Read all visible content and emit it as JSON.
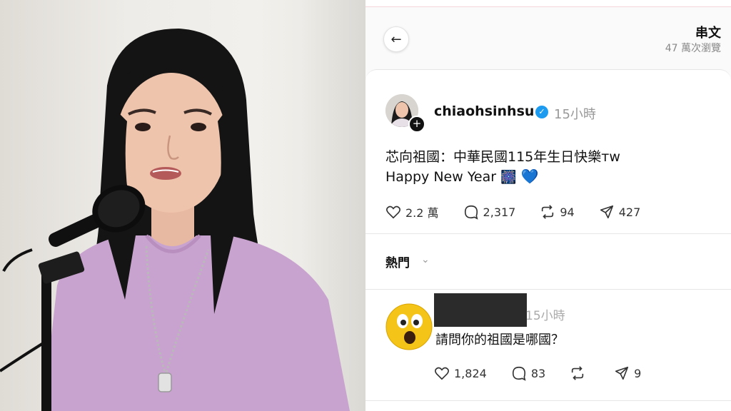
{
  "header": {
    "title": "串文",
    "views": "47 萬次瀏覽"
  },
  "post": {
    "username": "chiaohsinhsu",
    "time": "15小時",
    "line1": "芯向祖國：中華民國115年生日快樂ᴛᴡ",
    "line2": "Happy New Year",
    "line2_emoji": "🎆",
    "line2_heart": "💙",
    "likes": "2.2 萬",
    "comments": "2,317",
    "reposts": "94",
    "shares": "427"
  },
  "sort": {
    "label": "熱門"
  },
  "reply": {
    "time": "15小時",
    "text": "請問你的祖國是哪國？",
    "likes": "1,824",
    "comments": "83",
    "shares": "9"
  },
  "colors": {
    "verified": "#1d9bf0",
    "heart_emoji": "#1877f2",
    "shirt": "#c9a3cf",
    "emoji_yellow": "#f5c418"
  },
  "icons": [
    "back-arrow-icon",
    "plus-icon",
    "verified-badge-icon",
    "heart-icon",
    "comment-icon",
    "repost-icon",
    "share-icon",
    "chevron-down-icon",
    "surprised-face-emoji"
  ]
}
